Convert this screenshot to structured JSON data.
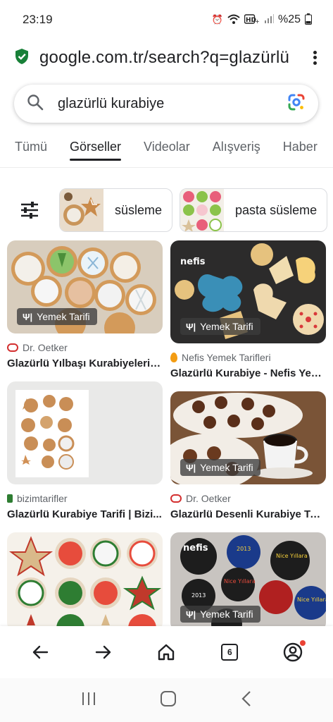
{
  "status": {
    "time": "23:19",
    "battery": "%25"
  },
  "browser": {
    "url": "google.com.tr/search?q=glazürlü"
  },
  "search": {
    "query": "glazürlü kurabiye"
  },
  "tabs": [
    "Tümü",
    "Görseller",
    "Videolar",
    "Alışveriş",
    "Haber"
  ],
  "chips": [
    {
      "label": "süsleme"
    },
    {
      "label": "pasta süsleme"
    }
  ],
  "results": [
    {
      "source": "Dr. Oetker",
      "title": "Glazürlü Yılbaşı Kurabiyeleri T...",
      "badge": "Yemek Tarifi"
    },
    {
      "source": "Nefis Yemek Tarifleri",
      "title": "Glazürlü Kurabiye - Nefis Yem...",
      "badge": "Yemek Tarifi"
    },
    {
      "source": "bizimtarifler",
      "title": "Glazürlü Kurabiye Tarifi | Bizi...",
      "badge": ""
    },
    {
      "source": "Dr. Oetker",
      "title": "Glazürlü Desenli Kurabiye Tar...",
      "badge": "Yemek Tarifi"
    },
    {
      "source": "",
      "title": "",
      "badge": ""
    },
    {
      "source": "",
      "title": "",
      "badge": "Yemek Tarifi"
    }
  ],
  "image_texts": {
    "nefis_logo": "nefis",
    "nice_yillara": "Nice Yıllara",
    "year": "2013"
  },
  "bottom_nav": {
    "tab_count": "6"
  },
  "colors": {
    "shield": "#188038",
    "accent_dot": "#ea4335",
    "text": "#202124",
    "muted": "#5f6368"
  }
}
